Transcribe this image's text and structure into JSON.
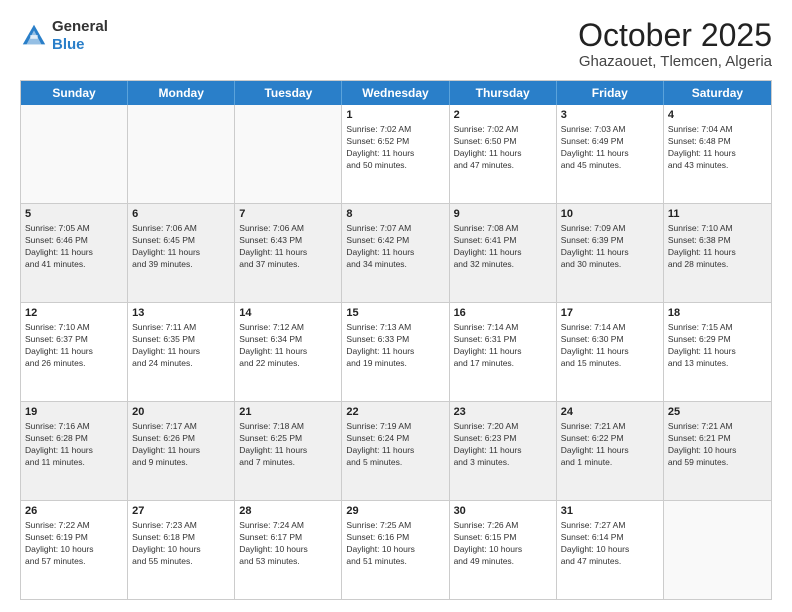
{
  "header": {
    "logo_line1": "General",
    "logo_line2": "Blue",
    "month": "October 2025",
    "location": "Ghazaouet, Tlemcen, Algeria"
  },
  "weekdays": [
    "Sunday",
    "Monday",
    "Tuesday",
    "Wednesday",
    "Thursday",
    "Friday",
    "Saturday"
  ],
  "rows": [
    [
      {
        "day": "",
        "info": ""
      },
      {
        "day": "",
        "info": ""
      },
      {
        "day": "",
        "info": ""
      },
      {
        "day": "1",
        "info": "Sunrise: 7:02 AM\nSunset: 6:52 PM\nDaylight: 11 hours\nand 50 minutes."
      },
      {
        "day": "2",
        "info": "Sunrise: 7:02 AM\nSunset: 6:50 PM\nDaylight: 11 hours\nand 47 minutes."
      },
      {
        "day": "3",
        "info": "Sunrise: 7:03 AM\nSunset: 6:49 PM\nDaylight: 11 hours\nand 45 minutes."
      },
      {
        "day": "4",
        "info": "Sunrise: 7:04 AM\nSunset: 6:48 PM\nDaylight: 11 hours\nand 43 minutes."
      }
    ],
    [
      {
        "day": "5",
        "info": "Sunrise: 7:05 AM\nSunset: 6:46 PM\nDaylight: 11 hours\nand 41 minutes."
      },
      {
        "day": "6",
        "info": "Sunrise: 7:06 AM\nSunset: 6:45 PM\nDaylight: 11 hours\nand 39 minutes."
      },
      {
        "day": "7",
        "info": "Sunrise: 7:06 AM\nSunset: 6:43 PM\nDaylight: 11 hours\nand 37 minutes."
      },
      {
        "day": "8",
        "info": "Sunrise: 7:07 AM\nSunset: 6:42 PM\nDaylight: 11 hours\nand 34 minutes."
      },
      {
        "day": "9",
        "info": "Sunrise: 7:08 AM\nSunset: 6:41 PM\nDaylight: 11 hours\nand 32 minutes."
      },
      {
        "day": "10",
        "info": "Sunrise: 7:09 AM\nSunset: 6:39 PM\nDaylight: 11 hours\nand 30 minutes."
      },
      {
        "day": "11",
        "info": "Sunrise: 7:10 AM\nSunset: 6:38 PM\nDaylight: 11 hours\nand 28 minutes."
      }
    ],
    [
      {
        "day": "12",
        "info": "Sunrise: 7:10 AM\nSunset: 6:37 PM\nDaylight: 11 hours\nand 26 minutes."
      },
      {
        "day": "13",
        "info": "Sunrise: 7:11 AM\nSunset: 6:35 PM\nDaylight: 11 hours\nand 24 minutes."
      },
      {
        "day": "14",
        "info": "Sunrise: 7:12 AM\nSunset: 6:34 PM\nDaylight: 11 hours\nand 22 minutes."
      },
      {
        "day": "15",
        "info": "Sunrise: 7:13 AM\nSunset: 6:33 PM\nDaylight: 11 hours\nand 19 minutes."
      },
      {
        "day": "16",
        "info": "Sunrise: 7:14 AM\nSunset: 6:31 PM\nDaylight: 11 hours\nand 17 minutes."
      },
      {
        "day": "17",
        "info": "Sunrise: 7:14 AM\nSunset: 6:30 PM\nDaylight: 11 hours\nand 15 minutes."
      },
      {
        "day": "18",
        "info": "Sunrise: 7:15 AM\nSunset: 6:29 PM\nDaylight: 11 hours\nand 13 minutes."
      }
    ],
    [
      {
        "day": "19",
        "info": "Sunrise: 7:16 AM\nSunset: 6:28 PM\nDaylight: 11 hours\nand 11 minutes."
      },
      {
        "day": "20",
        "info": "Sunrise: 7:17 AM\nSunset: 6:26 PM\nDaylight: 11 hours\nand 9 minutes."
      },
      {
        "day": "21",
        "info": "Sunrise: 7:18 AM\nSunset: 6:25 PM\nDaylight: 11 hours\nand 7 minutes."
      },
      {
        "day": "22",
        "info": "Sunrise: 7:19 AM\nSunset: 6:24 PM\nDaylight: 11 hours\nand 5 minutes."
      },
      {
        "day": "23",
        "info": "Sunrise: 7:20 AM\nSunset: 6:23 PM\nDaylight: 11 hours\nand 3 minutes."
      },
      {
        "day": "24",
        "info": "Sunrise: 7:21 AM\nSunset: 6:22 PM\nDaylight: 11 hours\nand 1 minute."
      },
      {
        "day": "25",
        "info": "Sunrise: 7:21 AM\nSunset: 6:21 PM\nDaylight: 10 hours\nand 59 minutes."
      }
    ],
    [
      {
        "day": "26",
        "info": "Sunrise: 7:22 AM\nSunset: 6:19 PM\nDaylight: 10 hours\nand 57 minutes."
      },
      {
        "day": "27",
        "info": "Sunrise: 7:23 AM\nSunset: 6:18 PM\nDaylight: 10 hours\nand 55 minutes."
      },
      {
        "day": "28",
        "info": "Sunrise: 7:24 AM\nSunset: 6:17 PM\nDaylight: 10 hours\nand 53 minutes."
      },
      {
        "day": "29",
        "info": "Sunrise: 7:25 AM\nSunset: 6:16 PM\nDaylight: 10 hours\nand 51 minutes."
      },
      {
        "day": "30",
        "info": "Sunrise: 7:26 AM\nSunset: 6:15 PM\nDaylight: 10 hours\nand 49 minutes."
      },
      {
        "day": "31",
        "info": "Sunrise: 7:27 AM\nSunset: 6:14 PM\nDaylight: 10 hours\nand 47 minutes."
      },
      {
        "day": "",
        "info": ""
      }
    ]
  ]
}
